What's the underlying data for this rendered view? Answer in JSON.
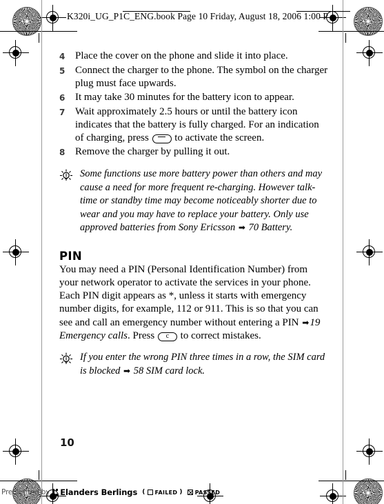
{
  "header": {
    "text": "K320i_UG_P1C_ENG.book  Page 10  Friday, August 18, 2006 1:00 P"
  },
  "steps": [
    {
      "num": "4",
      "text": "Place the cover on the phone and slide it into place."
    },
    {
      "num": "5",
      "text": "Connect the charger to the phone. The symbol on the charger plug must face upwards."
    },
    {
      "num": "6",
      "text": "It may take 30 minutes for the battery icon to appear."
    },
    {
      "num": "7",
      "text_before_key": "Wait approximately 2.5 hours or until the battery icon indicates that the battery is fully charged. For an indication of charging, press ",
      "key_label": "",
      "text_after_key": " to activate the screen."
    },
    {
      "num": "8",
      "text": "Remove the charger by pulling it out."
    }
  ],
  "note_battery": {
    "icon": "lightbulb-tip-icon",
    "text": "Some functions use more battery power than others and may cause a need for more frequent re-charging. However talk-time or standby time may become noticeably shorter due to wear and you may have to replace your battery. Only use approved batteries from Sony Ericsson ",
    "arrow": "➡",
    "reference": " 70 Battery."
  },
  "pin_section": {
    "heading": "PIN",
    "paragraph": "You may need a PIN (Personal Identification Number) from your network operator to activate the services in your phone. Each PIN digit appears as *, unless it starts with emergency number digits, for example, 112 or 911. This is so that you can see and call an emergency number without entering a PIN ",
    "arrow": "➡",
    "reference": "19 Emergency calls",
    "after_reference_before_key": ". Press ",
    "key_label": "c",
    "after_key": " to correct mistakes."
  },
  "note_pin": {
    "icon": "lightbulb-tip-icon",
    "text": "If you enter the wrong PIN three times in a row, the SIM card is blocked ",
    "arrow": "➡",
    "reference": " 58 SIM card lock."
  },
  "page_number": "10",
  "footer": {
    "preflight_label": "Preflighted by",
    "brand": "Elanders Berlings",
    "open_paren": "(",
    "failed_label": "FAILED",
    "close_paren": ")",
    "passed_label": "PASSED"
  },
  "colors": {
    "ink": "#000000",
    "step_number": "#3a3a3a",
    "preflight_gray": "#555555"
  }
}
